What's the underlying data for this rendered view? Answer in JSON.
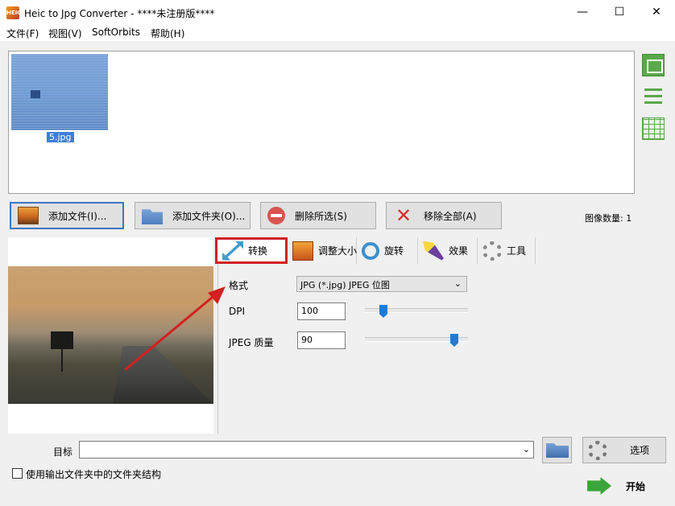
{
  "window": {
    "title": "Heic to Jpg Converter - ****未注册版****",
    "app_icon_text": "HEIC",
    "minimize": "—",
    "maximize": "☐",
    "close": "✕"
  },
  "menu": [
    "文件(F)",
    "视图(V)",
    "SoftOrbits",
    "帮助(H)"
  ],
  "thumbnails": [
    {
      "filename": "5.jpg",
      "selected": true
    }
  ],
  "view_icons": [
    "large-icons-view-icon",
    "list-view-icon",
    "table-view-icon"
  ],
  "toolbar": {
    "add_files": "添加文件(I)...",
    "add_folder": "添加文件夹(O)...",
    "delete_selected": "删除所选(S)",
    "remove_all": "移除全部(A)"
  },
  "image_count_label": "图像数量: 1",
  "tabs": [
    {
      "label": "转换",
      "icon": "convert-arrows-icon",
      "active": true
    },
    {
      "label": "调整大小",
      "icon": "resize-photos-icon",
      "active": false
    },
    {
      "label": "旋转",
      "icon": "rotate-icon",
      "active": false
    },
    {
      "label": "效果",
      "icon": "magic-wand-icon",
      "active": false
    },
    {
      "label": "工具",
      "icon": "gear-icon",
      "active": false
    }
  ],
  "settings": {
    "format_label": "格式",
    "format_value": "JPG (*.jpg) JPEG 位图",
    "dpi_label": "DPI",
    "dpi_value": "100",
    "dpi_slider_fraction": 0.15,
    "quality_label": "JPEG 质量",
    "quality_value": "90",
    "quality_slider_fraction": 0.9
  },
  "bottom": {
    "target_label": "目标",
    "target_value": "",
    "options_label": "选项",
    "folder_structure_label": "使用输出文件夹中的文件夹结构",
    "folder_structure_checked": false,
    "start_label": "开始"
  },
  "colors": {
    "accent": "#3b76c4",
    "highlight_box": "#d32020",
    "annotation_arrow": "#d32020",
    "slider_thumb": "#1e7bd8"
  }
}
